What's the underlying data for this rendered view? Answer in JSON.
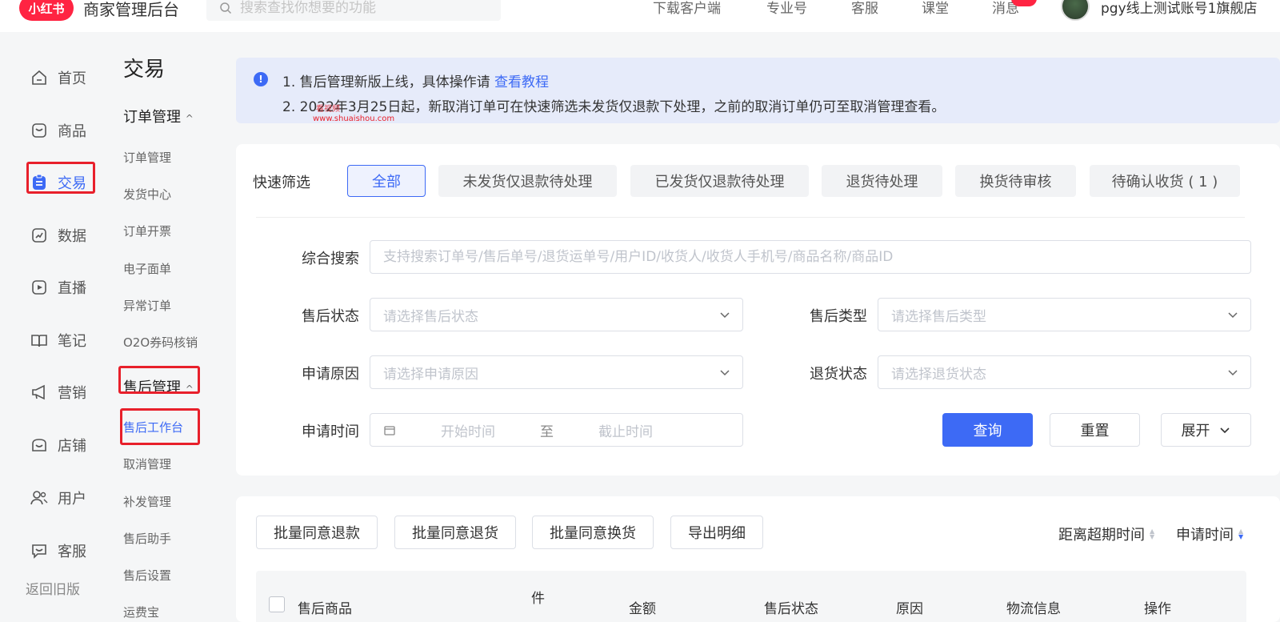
{
  "topbar": {
    "logo": "小红书",
    "title": "商家管理后台",
    "search_placeholder": "搜索查找你想要的功能",
    "links": [
      "下载客户端",
      "专业号",
      "客服",
      "课堂",
      "消息"
    ],
    "account": "pgy线上测试账号1旗舰店"
  },
  "leftnav": {
    "items": [
      {
        "label": "首页",
        "icon": "home-icon"
      },
      {
        "label": "商品",
        "icon": "bag-icon"
      },
      {
        "label": "交易",
        "icon": "clipboard-icon"
      },
      {
        "label": "数据",
        "icon": "chart-icon"
      },
      {
        "label": "直播",
        "icon": "play-icon"
      },
      {
        "label": "笔记",
        "icon": "book-icon"
      },
      {
        "label": "营销",
        "icon": "megaphone-icon"
      },
      {
        "label": "店铺",
        "icon": "store-icon"
      },
      {
        "label": "用户",
        "icon": "users-icon"
      },
      {
        "label": "客服",
        "icon": "chat-icon"
      }
    ],
    "back_old": "返回旧版"
  },
  "subnav": {
    "title": "交易",
    "group1": "订单管理",
    "group1_items": [
      "订单管理",
      "发货中心",
      "订单开票",
      "电子面单",
      "异常订单",
      "O2O券码核销"
    ],
    "group2": "售后管理",
    "group2_items": [
      "售后工作台",
      "取消管理",
      "补发管理",
      "售后助手",
      "售后设置",
      "运费宝"
    ]
  },
  "notice": {
    "line1": "1. 售后管理新版上线，具体操作请 ",
    "line1_link": "查看教程",
    "line2": "2. 2022年3月25日起，新取消订单可在快速筛选未发货仅退款下处理，之前的取消订单仍可至取消管理查看。",
    "watermark_top": "看视频",
    "watermark": "www.shuaishou.com"
  },
  "filters": {
    "quick_label": "快速筛选",
    "quick": [
      "全部",
      "未发货仅退款待处理",
      "已发货仅退款待处理",
      "退货待处理",
      "换货待审核",
      "待确认收货 ( 1 )"
    ],
    "search_label": "综合搜索",
    "search_placeholder": "支持搜索订单号/售后单号/退货运单号/用户ID/收货人/收货人手机号/商品名称/商品ID",
    "status_label": "售后状态",
    "status_placeholder": "请选择售后状态",
    "type_label": "售后类型",
    "type_placeholder": "请选择售后类型",
    "reason_label": "申请原因",
    "reason_placeholder": "请选择申请原因",
    "return_label": "退货状态",
    "return_placeholder": "请选择退货状态",
    "time_label": "申请时间",
    "start_placeholder": "开始时间",
    "to": "至",
    "end_placeholder": "截止时间",
    "query": "查询",
    "reset": "重置",
    "expand": "展开"
  },
  "batch": {
    "buttons": [
      "批量同意退款",
      "批量同意退货",
      "批量同意换货",
      "导出明细"
    ],
    "sort1": "距离超期时间",
    "sort2": "申请时间"
  },
  "table": {
    "headers": [
      "售后商品",
      "件",
      "金额",
      "售后状态",
      "原因",
      "物流信息",
      "操作"
    ]
  },
  "colors": {
    "brand": "#ff2442",
    "accent": "#3d6af5",
    "highlight": "#e8202b"
  }
}
